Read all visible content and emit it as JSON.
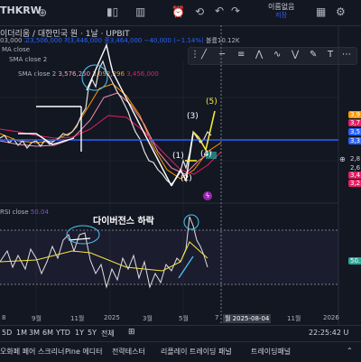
{
  "topbar": {
    "symbol": "THKRW",
    "account_label": "이름없음",
    "account_sub": "저장"
  },
  "legend": {
    "ohlc_prefix": "03,000",
    "ohlc": "고3,506,000 저3,446,000 종3,464,000 −40,000 (−1.14%)",
    "volume": "볼륨10.12K",
    "title": "이더리움 / 대한민국 원 · 1날 · UPBIT",
    "ma_close": "MA close",
    "sma2": "SMA close 2",
    "sma2_v1": "3,576,250",
    "sma2_v2": "3,092,296",
    "sma2_v3": "3,456,000",
    "rsi_label": "RSI close",
    "rsi_value": "50.04",
    "divergence_text": "다이버전스 하락"
  },
  "wave_labels": [
    "(1)",
    "(2)",
    "(3)",
    "(4)",
    "(5)"
  ],
  "price_axis": [
    "3,9",
    "3,7",
    "3,5",
    "3,3",
    "2,8",
    "2,6",
    "3,4",
    "3,2"
  ],
  "price_marker": "3,4",
  "rsi_axis": "50.",
  "x_axis": [
    "8",
    "9월",
    "11월",
    "2025",
    "3월",
    "5월",
    "7",
    "11월",
    "2026"
  ],
  "x_crosshair_label": "월 2025-08-04",
  "timeframes": [
    "5D",
    "1M",
    "3M",
    "6M",
    "YTD",
    "1Y",
    "5Y",
    "전체"
  ],
  "clock": "22:25:42 U",
  "bottom_tabs": [
    "오화페 페어 스크리너",
    "Pine 에디터",
    "전략테스터",
    "리플레이 트레이딩 패널",
    "트레이딩패널"
  ],
  "colors": {
    "background": "#131722",
    "horizontal_line": "#2962ff",
    "annotation_white": "#ffffff",
    "annotation_yellow": "#f5e642",
    "rsi_line": "#7e57c2",
    "rsi_ma": "#f5e642",
    "ma_orange": "#ff9800",
    "ma_red": "#e91e63",
    "up_candle": "#e0e0e0",
    "down_candle": "#e91e63"
  }
}
